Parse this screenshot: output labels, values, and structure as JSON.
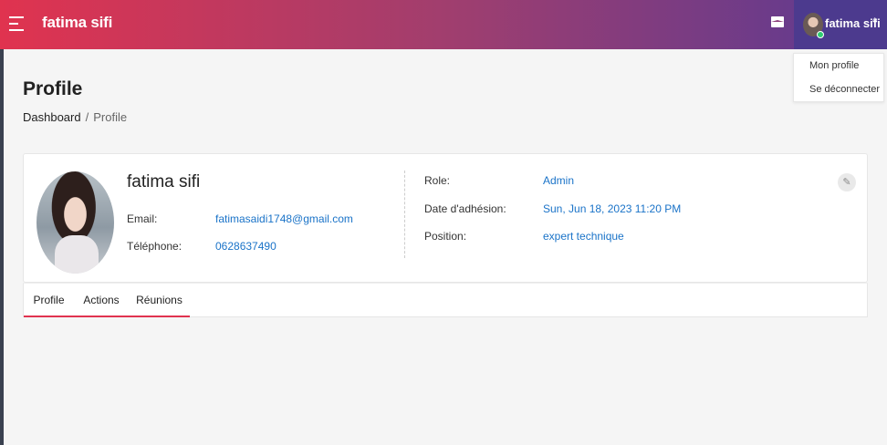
{
  "header": {
    "app_title": "fatima sifi",
    "user_name": "fatima sifi",
    "icons": {
      "menu": "hamburger-icon",
      "mail": "envelope-icon",
      "caret": "chevron-up-icon"
    }
  },
  "user_menu": {
    "items": [
      {
        "label": "Mon profile"
      },
      {
        "label": "Se déconnecter"
      }
    ]
  },
  "page": {
    "title": "Profile",
    "breadcrumb": {
      "home": "Dashboard",
      "separator": "/",
      "current": "Profile"
    }
  },
  "profile": {
    "name": "fatima sifi",
    "email_label": "Email:",
    "email": "fatimasaidi1748@gmail.com",
    "phone_label": "Téléphone:",
    "phone": "0628637490",
    "role_label": "Role:",
    "role": "Admin",
    "joined_label": "Date d'adhésion:",
    "joined": "Sun, Jun 18, 2023 11:20 PM",
    "position_label": "Position:",
    "position": "expert technique"
  },
  "tabs": [
    {
      "label": "Profile"
    },
    {
      "label": "Actions"
    },
    {
      "label": "Réunions"
    }
  ],
  "colors": {
    "accent": "#e0334f",
    "gradient_start": "#e0334f",
    "gradient_end": "#5a3a93",
    "link": "#1a73c8"
  }
}
